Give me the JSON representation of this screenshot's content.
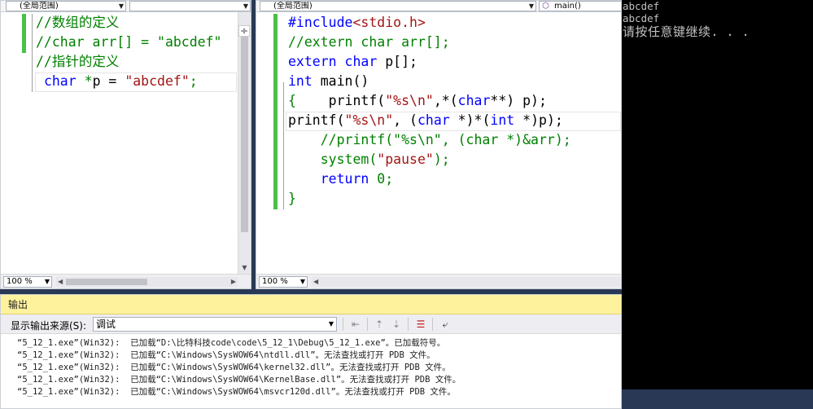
{
  "left_editor": {
    "nav_combo_1": "(全局范围)",
    "nav_combo_2": "",
    "split_glyph": "÷",
    "zoom": "100 %",
    "lines": [
      {
        "parts": [
          {
            "t": "//数组的定义",
            "c": "cmt"
          }
        ]
      },
      {
        "parts": [
          {
            "t": "//char arr[] = \"abcdef\"",
            "c": "cmt"
          }
        ]
      },
      {
        "parts": [
          {
            "t": "//指针的定义",
            "c": "cmt"
          }
        ]
      },
      {
        "parts": [
          {
            "t": " ",
            "c": "txt"
          },
          {
            "t": "char",
            "c": "kw"
          },
          {
            "t": " *",
            "c": "cmt"
          },
          {
            "t": "p = ",
            "c": "txt"
          },
          {
            "t": "\"abcdef\"",
            "c": "str"
          },
          {
            "t": ";",
            "c": "cmt"
          }
        ]
      }
    ]
  },
  "right_editor": {
    "nav_combo_1": "(全局范围)",
    "nav_combo_2": "main()",
    "zoom": "100 %",
    "lines": [
      {
        "parts": [
          {
            "t": "#include",
            "c": "kw"
          },
          {
            "t": "<stdio.h>",
            "c": "str"
          }
        ]
      },
      {
        "parts": [
          {
            "t": "//extern char arr[];",
            "c": "cmt"
          }
        ]
      },
      {
        "parts": [
          {
            "t": "extern",
            "c": "kw"
          },
          {
            "t": " ",
            "c": "txt"
          },
          {
            "t": "char",
            "c": "kw"
          },
          {
            "t": " p[];",
            "c": "txt"
          }
        ]
      },
      {
        "parts": [
          {
            "t": "int",
            "c": "kw"
          },
          {
            "t": " main()",
            "c": "txt"
          }
        ]
      },
      {
        "parts": [
          {
            "t": "{",
            "c": "cmt"
          },
          {
            "t": "    printf(",
            "c": "txt"
          },
          {
            "t": "\"%s\\n\"",
            "c": "str"
          },
          {
            "t": ",*(",
            "c": "txt"
          },
          {
            "t": "char",
            "c": "kw"
          },
          {
            "t": "**) p);",
            "c": "txt"
          }
        ]
      },
      {
        "parts": [
          {
            "t": "printf(",
            "c": "txt"
          },
          {
            "t": "\"%s\\n\"",
            "c": "str"
          },
          {
            "t": ", (",
            "c": "txt"
          },
          {
            "t": "char",
            "c": "kw"
          },
          {
            "t": " *)*(",
            "c": "txt"
          },
          {
            "t": "int",
            "c": "kw"
          },
          {
            "t": " *)p);",
            "c": "txt"
          }
        ]
      },
      {
        "parts": [
          {
            "t": "    //printf(\"%s\\n\", (char *)&arr);",
            "c": "cmt"
          }
        ]
      },
      {
        "parts": [
          {
            "t": "    system(",
            "c": "cmt"
          },
          {
            "t": "\"pause\"",
            "c": "str"
          },
          {
            "t": ");",
            "c": "cmt"
          }
        ]
      },
      {
        "parts": [
          {
            "t": "    ",
            "c": "txt"
          },
          {
            "t": "return",
            "c": "kw"
          },
          {
            "t": " 0;",
            "c": "cmt"
          }
        ]
      },
      {
        "parts": [
          {
            "t": "}",
            "c": "cmt"
          }
        ]
      }
    ]
  },
  "console": {
    "lines": [
      "abcdef",
      "abcdef",
      "请按任意键继续. . ."
    ]
  },
  "output": {
    "title": "输出",
    "source_label": "显示输出来源(S):",
    "source_value": "调试",
    "lines": [
      "“5_12_1.exe”(Win32):  已加载“D:\\比特科技code\\code\\5_12_1\\Debug\\5_12_1.exe”。已加载符号。",
      "“5_12_1.exe”(Win32):  已加载“C:\\Windows\\SysWOW64\\ntdll.dll”。无法查找或打开 PDB 文件。",
      "“5_12_1.exe”(Win32):  已加载“C:\\Windows\\SysWOW64\\kernel32.dll”。无法查找或打开 PDB 文件。",
      "“5_12_1.exe”(Win32):  已加载“C:\\Windows\\SysWOW64\\KernelBase.dll”。无法查找或打开 PDB 文件。",
      "“5_12_1.exe”(Win32):  已加载“C:\\Windows\\SysWOW64\\msvcr120d.dll”。无法查找或打开 PDB 文件。"
    ]
  },
  "colors": {
    "change_bar": "#49c047",
    "output_title_bg": "#fff29d",
    "keyword": "#0000ff",
    "string": "#a31515",
    "comment": "#008000"
  }
}
